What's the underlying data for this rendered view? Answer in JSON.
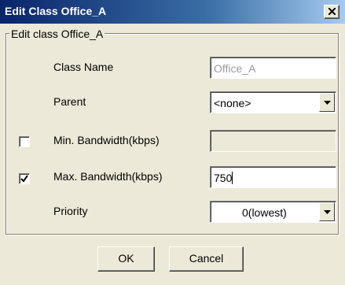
{
  "window": {
    "title": "Edit Class Office_A",
    "close_icon": "close-x-icon"
  },
  "group": {
    "legend": "Edit class Office_A"
  },
  "form": {
    "class_name": {
      "label": "Class Name",
      "value": "Office_A"
    },
    "parent": {
      "label": "Parent",
      "value": "<none>"
    },
    "min_bandwidth": {
      "label": "Min. Bandwidth(kbps)",
      "checked": false,
      "value": ""
    },
    "max_bandwidth": {
      "label": "Max. Bandwidth(kbps)",
      "checked": true,
      "value": "750"
    },
    "priority": {
      "label": "Priority",
      "value": "0(lowest)"
    }
  },
  "buttons": {
    "ok": "OK",
    "cancel": "Cancel"
  },
  "colors": {
    "title_bar": "#0a246a",
    "dialog_bg": "#ece9d8",
    "disabled_text": "#9a9a9a"
  }
}
